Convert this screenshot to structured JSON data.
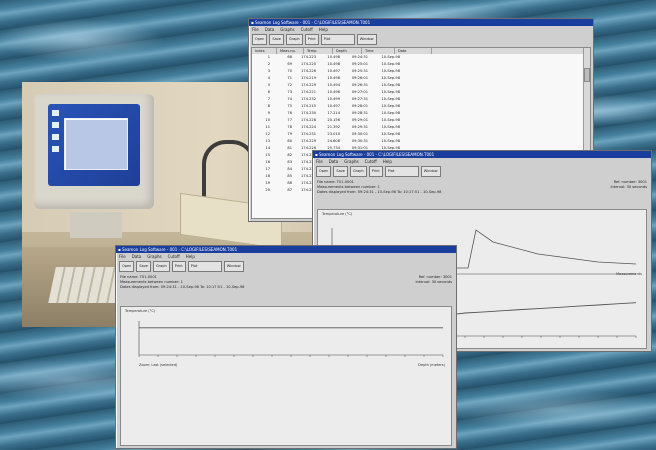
{
  "windows": {
    "top": {
      "title": "▪ Seamon Log Software - 001 - C:\\LOGIFILES\\SEAMON.T001",
      "menu": [
        "File",
        "Data",
        "Graphs",
        "Cutoff",
        "Help"
      ],
      "toolbar": [
        "Open",
        "Save",
        "Graph",
        "Print",
        "Plot",
        "Window"
      ],
      "columns": [
        "Index",
        "Meas.no.",
        "Temp.",
        "Depth",
        "Time",
        "Date"
      ],
      "rows": [
        [
          "1",
          "68",
          "174.223",
          "10.498",
          "09:24:31",
          "10-Sep-98"
        ],
        [
          "2",
          "69",
          "174.220",
          "10.498",
          "09:25:01",
          "10-Sep-98"
        ],
        [
          "3",
          "70",
          "174.226",
          "10.497",
          "09:25:31",
          "10-Sep-98"
        ],
        [
          "4",
          "71",
          "174.219",
          "10.498",
          "09:26:01",
          "10-Sep-98"
        ],
        [
          "5",
          "72",
          "174.229",
          "10.494",
          "09:26:31",
          "10-Sep-98"
        ],
        [
          "6",
          "73",
          "174.221",
          "10.496",
          "09:27:01",
          "10-Sep-98"
        ],
        [
          "7",
          "74",
          "174.232",
          "10.499",
          "09:27:31",
          "10-Sep-98"
        ],
        [
          "8",
          "75",
          "174.215",
          "10.497",
          "09:28:01",
          "10-Sep-98"
        ],
        [
          "9",
          "76",
          "174.230",
          "17.214",
          "09:28:31",
          "10-Sep-98"
        ],
        [
          "10",
          "77",
          "174.228",
          "20.156",
          "09:29:01",
          "10-Sep-98"
        ],
        [
          "11",
          "78",
          "174.224",
          "21.392",
          "09:29:31",
          "10-Sep-98"
        ],
        [
          "12",
          "79",
          "174.231",
          "23.010",
          "09:30:01",
          "10-Sep-98"
        ],
        [
          "13",
          "80",
          "174.229",
          "24.608",
          "09:30:31",
          "10-Sep-98"
        ],
        [
          "14",
          "81",
          "174.226",
          "25.734",
          "09:31:01",
          "10-Sep-98"
        ],
        [
          "15",
          "82",
          "174.220",
          "26.903",
          "09:31:31",
          "10-Sep-98"
        ],
        [
          "16",
          "83",
          "174.225",
          "27.511",
          "09:32:01",
          "10-Sep-98"
        ],
        [
          "17",
          "84",
          "174.222",
          "28.006",
          "09:32:31",
          "10-Sep-98"
        ],
        [
          "18",
          "85",
          "174.227",
          "28.350",
          "09:33:01",
          "10-Sep-98"
        ],
        [
          "19",
          "86",
          "174.223",
          "28.712",
          "09:33:31",
          "10-Sep-98"
        ],
        [
          "20",
          "87",
          "174.224",
          "28.918",
          "09:34:01",
          "10-Sep-98"
        ]
      ]
    },
    "right": {
      "title": "▪ Seamon Log Software - 001 - C:\\LOGIFILES\\SEAMON.T001",
      "menu": [
        "File",
        "Data",
        "Graphs",
        "Cutoff",
        "Help"
      ],
      "toolbar": [
        "Open",
        "Save",
        "Graph",
        "Print",
        "Plot",
        "Window"
      ],
      "info": {
        "file_name": "File name: T01-0001",
        "ref_number": "Ref. number: 3001",
        "measurements": "Measurements between number: 1",
        "interval": "Interval: 30 seconds",
        "dates": "Dates displayed from: 09:24:31 - 10-Sep-98 To: 10:17:51 - 10-Sep-98"
      },
      "plot_title": "Temperature (°C)",
      "x_unit": "Measurements"
    },
    "bottom": {
      "title": "▪ Seamon Log Software - 001 - C:\\LOGIFILES\\SEAMON.T001",
      "menu": [
        "File",
        "Data",
        "Graphs",
        "Cutoff",
        "Help"
      ],
      "toolbar": [
        "Open",
        "Save",
        "Graph",
        "Print",
        "Plot",
        "Window"
      ],
      "info": {
        "file_name": "File name: T01-0001",
        "ref_number": "Ref. number: 3001",
        "measurements": "Measurements between number: 1",
        "interval": "Interval: 30 seconds",
        "dates": "Dates displayed from: 09:24:31 - 10-Sep-98 To: 10:17:51 - 10-Sep-98"
      },
      "plot_title": "Temperature (°C)",
      "x_left_label": "Zoom: Last (selected)",
      "x_right_label": "Depth (meters)"
    }
  },
  "colors": {
    "titlebar": "#1a3e9e",
    "window_bg": "#cfcfcf",
    "plot_line": "#555555"
  },
  "chart_data": [
    {
      "type": "line",
      "title": "Temperature (°C)",
      "xlabel": "Measurements",
      "x": [
        0,
        20,
        40,
        60,
        80,
        100,
        120,
        140,
        160,
        180,
        200,
        220,
        240,
        260,
        280,
        300,
        320
      ],
      "series": [
        {
          "values": [
            3.2,
            3.2,
            3.2,
            3.3,
            3.4,
            3.6,
            3.8,
            4.0,
            4.1,
            4.2,
            4.3,
            4.4,
            4.5,
            4.6,
            4.7,
            4.8,
            4.9
          ]
        }
      ]
    },
    {
      "type": "line",
      "title": "Temperature (°C)",
      "x": [
        0,
        20,
        40,
        60,
        80,
        100,
        120,
        140,
        160,
        180,
        200,
        220,
        240,
        260,
        280,
        300,
        320
      ],
      "series": [
        {
          "values": [
            8.0,
            8.0,
            8.0,
            8.0,
            8.0,
            8.0,
            8.0,
            8.0,
            8.0,
            8.0,
            8.0,
            8.0,
            8.0,
            8.0,
            8.0,
            8.0,
            8.0
          ]
        }
      ]
    }
  ]
}
